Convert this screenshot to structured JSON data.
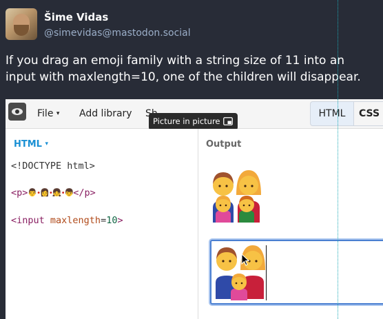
{
  "post": {
    "display_name": "Šime Vidas",
    "handle": "@simevidas@mastodon.social",
    "text": "If you drag an emoji family with a string size of 11 into an input with maxlength=10, one of the children will disappear."
  },
  "editor": {
    "menu_file": "File",
    "menu_add_library": "Add library",
    "menu_share": "Sh",
    "tab_html": "HTML",
    "tab_css": "CSS",
    "tooltip": "Picture in picture",
    "language": "HTML",
    "code_line1": "<!DOCTYPE html>",
    "code_p_open": "<p>",
    "code_p_close": "</p>",
    "code_emoji": "👨‍👩‍👧‍👦",
    "code_input_open": "<input ",
    "code_input_attr": "maxlength",
    "code_input_eq": "=",
    "code_input_value": "10",
    "code_input_close": ">",
    "output_label": "Output"
  },
  "icons": {
    "caret": "▾",
    "logo": "jsbin-eye-icon",
    "pip": "picture-in-picture-icon"
  },
  "colors": {
    "page_bg": "#282c37",
    "handle": "#9baec8",
    "accent_blue": "#1a90d4",
    "focus_ring": "#4a7fd1"
  }
}
